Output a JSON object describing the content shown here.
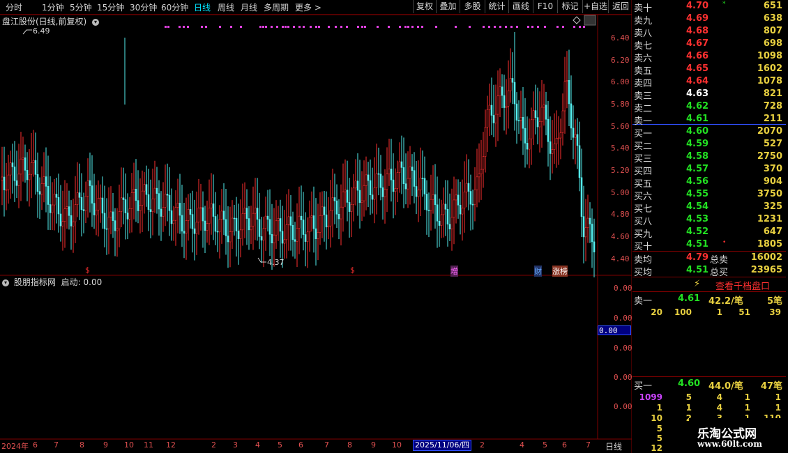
{
  "toolbar": {
    "periods": [
      "分时",
      "1分钟",
      "5分钟",
      "15分钟",
      "30分钟",
      "60分钟",
      "日线",
      "周线",
      "月线",
      "多周期",
      "更多"
    ],
    "active_period": "日线",
    "buttons": [
      "复权",
      "叠加",
      "多股",
      "统计",
      "画线",
      "F10",
      "标记",
      "+自选",
      "返回"
    ]
  },
  "main_chart": {
    "title": "盘江股份(日线,前复权)",
    "high_marker": "6.49",
    "low_marker": "4.37",
    "y_ticks": [
      "6.40",
      "6.20",
      "6.00",
      "5.80",
      "5.60",
      "5.40",
      "5.20",
      "5.00",
      "4.80",
      "4.60",
      "4.40"
    ],
    "events": [
      {
        "text": "$",
        "color": "#ff3030"
      },
      {
        "text": "$",
        "color": "#ff3030"
      },
      {
        "text": "增",
        "color": "#ff66ff"
      },
      {
        "text": "财",
        "color": "#66aaff"
      },
      {
        "text": "涨榜",
        "color": "#ffffff"
      }
    ]
  },
  "indicator": {
    "title": "股朋指标网",
    "value_label": "启动: 0.00",
    "y_ticks": [
      "0.00",
      "0.00",
      "0.00",
      "0.00",
      "0.00"
    ],
    "cursor_value": "0.00"
  },
  "x_axis": {
    "labels": [
      "2024年",
      "6",
      "7",
      "8",
      "9",
      "10",
      "11",
      "12",
      "2",
      "3",
      "4",
      "5",
      "6",
      "7",
      "8",
      "9",
      "10",
      "2",
      "4",
      "5",
      "6",
      "7"
    ],
    "cursor_date": "2025/11/06/四",
    "period_label": "日线"
  },
  "order_book": {
    "asks": [
      {
        "label": "卖十",
        "price": "4.70",
        "vol": "651",
        "mark": "*"
      },
      {
        "label": "卖九",
        "price": "4.69",
        "vol": "638"
      },
      {
        "label": "卖八",
        "price": "4.68",
        "vol": "807"
      },
      {
        "label": "卖七",
        "price": "4.67",
        "vol": "698"
      },
      {
        "label": "卖六",
        "price": "4.66",
        "vol": "1098"
      },
      {
        "label": "卖五",
        "price": "4.65",
        "vol": "1602"
      },
      {
        "label": "卖四",
        "price": "4.64",
        "vol": "1078"
      },
      {
        "label": "卖三",
        "price": "4.63",
        "vol": "821"
      },
      {
        "label": "卖二",
        "price": "4.62",
        "vol": "728"
      },
      {
        "label": "卖一",
        "price": "4.61",
        "vol": "211"
      }
    ],
    "bids": [
      {
        "label": "买一",
        "price": "4.60",
        "vol": "2070"
      },
      {
        "label": "买二",
        "price": "4.59",
        "vol": "527"
      },
      {
        "label": "买三",
        "price": "4.58",
        "vol": "2750"
      },
      {
        "label": "买四",
        "price": "4.57",
        "vol": "370"
      },
      {
        "label": "买五",
        "price": "4.56",
        "vol": "904"
      },
      {
        "label": "买六",
        "price": "4.55",
        "vol": "3750"
      },
      {
        "label": "买七",
        "price": "4.54",
        "vol": "325"
      },
      {
        "label": "买八",
        "price": "4.53",
        "vol": "1231"
      },
      {
        "label": "买九",
        "price": "4.52",
        "vol": "647"
      },
      {
        "label": "买十",
        "price": "4.51",
        "vol": "1805",
        "mark": "•"
      }
    ],
    "avg_sell": {
      "label": "卖均",
      "price": "4.79",
      "total_label": "总卖",
      "total": "16002"
    },
    "avg_buy": {
      "label": "买均",
      "price": "4.51",
      "total_label": "总买",
      "total": "23965"
    },
    "view_ten": "查看千档盘口",
    "sell1": {
      "label": "卖一",
      "price": "4.61",
      "avg": "42.2/笔",
      "count": "5笔",
      "items": [
        "20",
        "100",
        "1",
        "51",
        "39"
      ]
    },
    "buy1": {
      "label": "买一",
      "price": "4.60",
      "avg": "44.0/笔",
      "count": "47笔",
      "rows": [
        [
          "1099",
          "5",
          "4",
          "1",
          "1"
        ],
        [
          "1",
          "1",
          "4",
          "1",
          "1"
        ],
        [
          "10",
          "2",
          "3",
          "1",
          "110"
        ]
      ],
      "extra": [
        "5",
        "5",
        "12"
      ]
    }
  },
  "watermark": {
    "name": "乐淘公式网",
    "url": "www.60lt.com"
  },
  "colors": {
    "up": "#ff3030",
    "down": "#54f0f0",
    "grid": "#800000",
    "active": "#00e5ff"
  }
}
